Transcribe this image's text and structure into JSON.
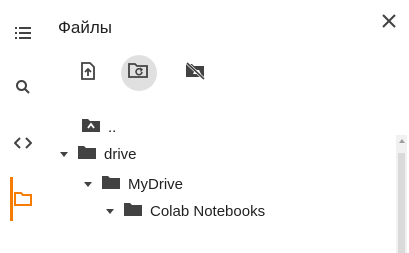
{
  "rail": {
    "items": [
      {
        "name": "toc-icon"
      },
      {
        "name": "search-icon"
      },
      {
        "name": "code-snippets-icon"
      },
      {
        "name": "files-icon",
        "active": true
      }
    ]
  },
  "panel": {
    "title": "Файлы",
    "toolbar": [
      {
        "name": "upload-icon"
      },
      {
        "name": "refresh-folder-icon",
        "hovered": true
      },
      {
        "name": "mount-drive-icon"
      }
    ],
    "tree": [
      {
        "label": "..",
        "type": "parent",
        "expanded": false
      },
      {
        "label": "drive",
        "type": "folder",
        "expanded": true
      },
      {
        "label": "MyDrive",
        "type": "folder",
        "expanded": true
      },
      {
        "label": "Colab Notebooks",
        "type": "folder",
        "expanded": true
      }
    ]
  },
  "colors": {
    "accent": "#f57c00",
    "icon": "#424242",
    "hover": "#e0e0e0"
  }
}
